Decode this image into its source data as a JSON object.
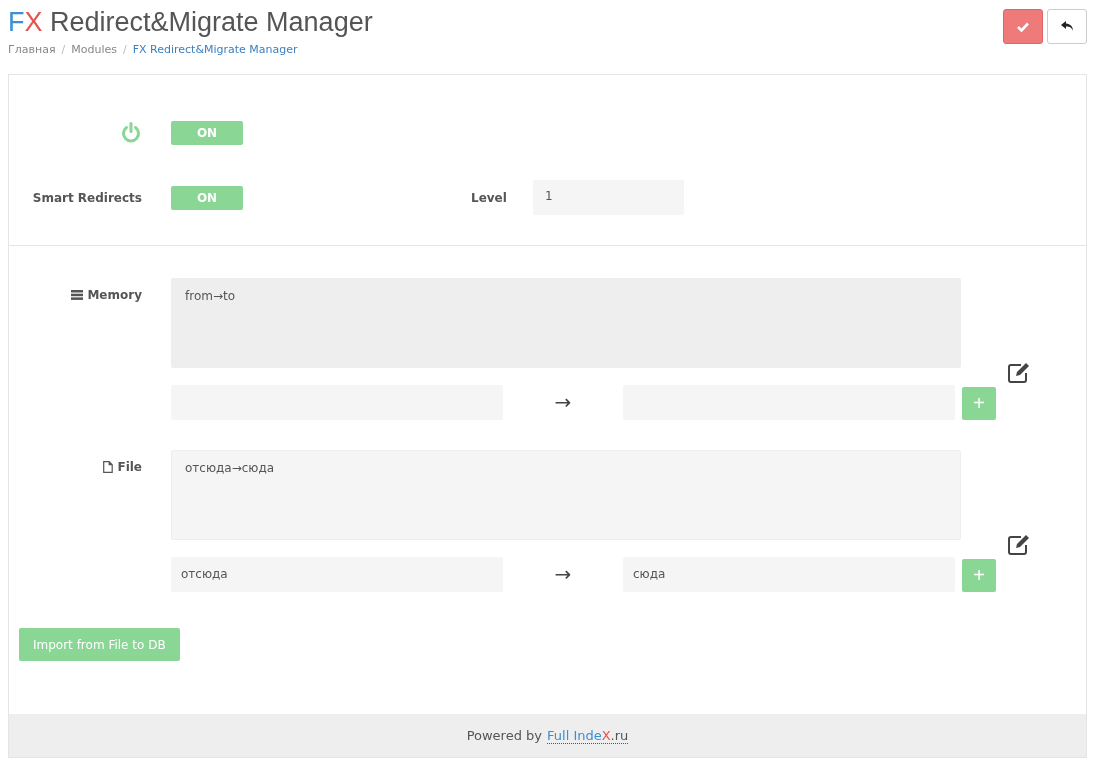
{
  "header": {
    "title": {
      "logo_first": "F",
      "logo_second": "X",
      "rest": "Redirect&Migrate Manager"
    },
    "breadcrumbs": [
      {
        "label": "Главная",
        "current": false
      },
      {
        "separator": "/",
        "label": "Modules",
        "current": false
      },
      {
        "separator": "/",
        "label": "FX Redirect&Migrate Manager",
        "current": true
      }
    ]
  },
  "settings": [
    {
      "kind": "power",
      "toggle": "ON",
      "on": true
    },
    {
      "kind": "smart",
      "label": "Smart Redirects",
      "toggle": "ON",
      "on": true,
      "level_label": "Level",
      "level_value": "1"
    }
  ],
  "sections": [
    {
      "kind": "memory",
      "label": "Memory",
      "textarea": "from→to",
      "arrow": "→",
      "add": "+"
    },
    {
      "kind": "file",
      "label": "File",
      "textarea": "отсюда→сюда",
      "from": "отсюда",
      "to": "сюда",
      "arrow": "→",
      "add": "+"
    }
  ],
  "import_button": "Import from File to DB",
  "footer": {
    "text": "Powered by",
    "link_a": "Full Inde",
    "link_b": "X",
    "link_c": ".ru"
  }
}
